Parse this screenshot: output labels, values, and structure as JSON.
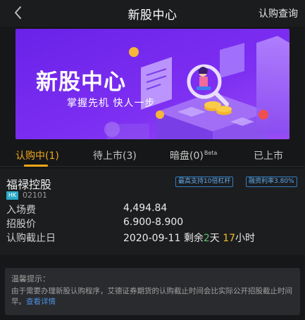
{
  "header": {
    "title": "新股中心",
    "query_label": "认购查询"
  },
  "banner": {
    "title": "新股中心",
    "subtitle": "掌握先机 快人一步"
  },
  "tabs": [
    {
      "label": "认购中(1)",
      "active": true
    },
    {
      "label": "待上市(3)",
      "active": false
    },
    {
      "label": "暗盘(0)",
      "sup": "Beta",
      "active": false
    },
    {
      "label": "已上市",
      "active": false
    }
  ],
  "stock": {
    "name": "福禄控股",
    "market": "HK",
    "code": "02101",
    "tags": [
      "最高支持10倍杠杆",
      "融资利率3.80%"
    ],
    "rows": {
      "entry_fee_label": "入场费",
      "entry_fee_value": "4,494.84",
      "price_label": "招股价",
      "price_value": "6.900-8.900",
      "deadline_label": "认购截止日",
      "deadline_date": "2020-09-11",
      "remaining_prefix": "剩余",
      "days": "2",
      "days_unit": "天",
      "hours": "17",
      "hours_unit": "小时"
    }
  },
  "notice": {
    "title": "温馨提示：",
    "body": "由于需要办理新股认购程序，艾德证券期货的认购截止时间会比实际公开招股截止时间早。",
    "link": "查看详情"
  },
  "colors": {
    "accent": "#f0a818",
    "banner_purple": "#7a2cf0",
    "tag_blue": "#2f7fc2",
    "days_green": "#5fc46a",
    "hours_yellow": "#f0c020"
  }
}
